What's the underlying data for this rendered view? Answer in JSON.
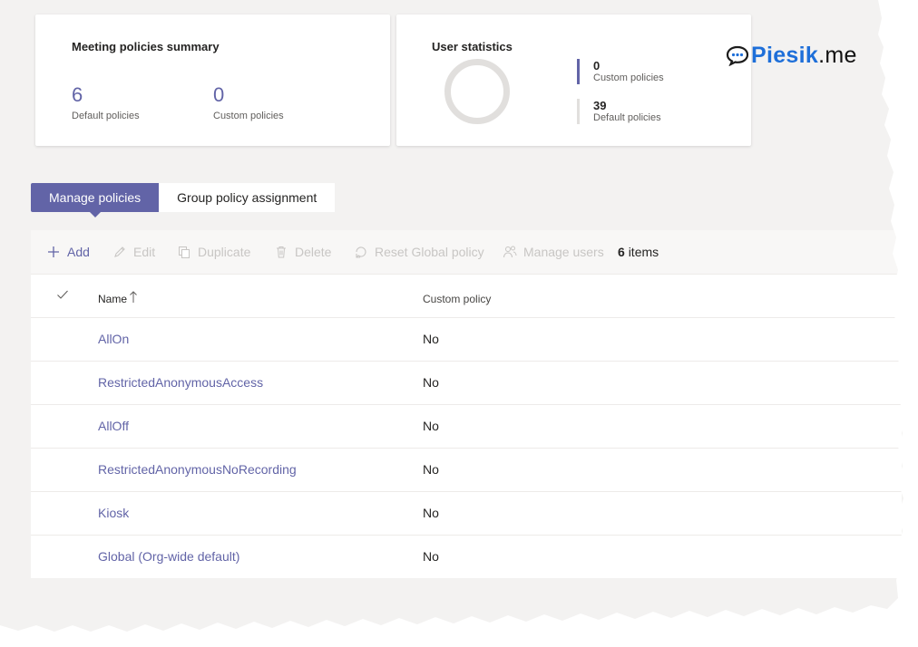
{
  "summary_card": {
    "title": "Meeting policies summary",
    "default_count": "6",
    "default_label": "Default policies",
    "custom_count": "0",
    "custom_label": "Custom policies"
  },
  "user_stats": {
    "title": "User statistics",
    "custom_num": "0",
    "custom_label": "Custom policies",
    "default_num": "39",
    "default_label": "Default policies"
  },
  "watermark": {
    "name": "Piesik",
    "suffix": ".me"
  },
  "tabs": [
    {
      "label": "Manage policies",
      "active": true
    },
    {
      "label": "Group policy assignment",
      "active": false
    }
  ],
  "toolbar": {
    "add": "Add",
    "edit": "Edit",
    "duplicate": "Duplicate",
    "delete": "Delete",
    "reset": "Reset Global policy",
    "manage_users": "Manage users",
    "count_num": "6",
    "count_label": "items"
  },
  "table": {
    "columns": [
      "Name",
      "Custom policy"
    ],
    "rows": [
      {
        "name": "AllOn",
        "custom": "No"
      },
      {
        "name": "RestrictedAnonymousAccess",
        "custom": "No"
      },
      {
        "name": "AllOff",
        "custom": "No"
      },
      {
        "name": "RestrictedAnonymousNoRecording",
        "custom": "No"
      },
      {
        "name": "Kiosk",
        "custom": "No"
      },
      {
        "name": "Global (Org-wide default)",
        "custom": "No"
      }
    ]
  },
  "colors": {
    "accent": "#6264a7",
    "donut": "#e1dfdd",
    "default_bar": "#e1dfdd"
  }
}
